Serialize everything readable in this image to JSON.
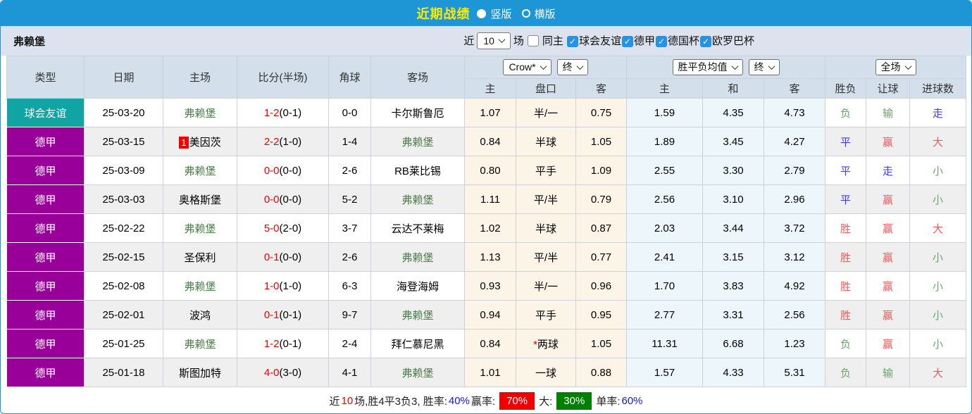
{
  "colors": {
    "accent_blue": "#1e96d5",
    "title_yellow": "#ffeb00",
    "friendly_teal": "#12a3a3",
    "league_purple": "#990099",
    "score_red": "#f00000",
    "focus_team_green": "#4a7d4a",
    "win_red": "#ef5a5a",
    "draw_blue": "#3c3cf0",
    "lose_green": "#6aa56a"
  },
  "top_bar": {
    "title": "近期战绩",
    "radio_vertical": "竖版",
    "radio_horizontal": "横版",
    "selected": "竖版"
  },
  "filter_bar": {
    "team": "弗赖堡",
    "recent_label": "近",
    "recent_count": "10",
    "games_label": "场",
    "same_home_label": "同主",
    "same_home_checked": false,
    "filters": [
      {
        "label": "球会友谊",
        "checked": true
      },
      {
        "label": "德甲",
        "checked": true
      },
      {
        "label": "德国杯",
        "checked": true
      },
      {
        "label": "欧罗巴杯",
        "checked": true
      }
    ]
  },
  "table": {
    "static_headers": [
      "类型",
      "日期",
      "主场",
      "比分(半场)",
      "角球",
      "客场"
    ],
    "group_headers": {
      "odds_source": "Crow*",
      "odds_time": "终",
      "mean_label": "胜平负均值",
      "mean_time": "终",
      "result_scope": "全场"
    },
    "sub_headers": [
      "主",
      "盘口",
      "客",
      "主",
      "和",
      "客",
      "胜负",
      "让球",
      "进球数"
    ],
    "rows": [
      {
        "type": "球会友谊",
        "type_style": "friendly",
        "date": "25-03-20",
        "home": "弗赖堡",
        "home_focus": true,
        "home_rank": "",
        "score": "1-2",
        "half": "(0-1)",
        "corner": "0-0",
        "away": "卡尔斯鲁厄",
        "away_focus": false,
        "odds_home": "1.07",
        "handicap": "半/一",
        "handicap_star": false,
        "odds_away": "0.75",
        "mean_home": "1.59",
        "mean_draw": "4.35",
        "mean_away": "4.73",
        "result": "负",
        "let_result": "输",
        "goals_result": "走"
      },
      {
        "type": "德甲",
        "type_style": "league",
        "date": "25-03-15",
        "home": "美因茨",
        "home_focus": false,
        "home_rank": "1",
        "score": "2-2",
        "half": "(1-0)",
        "corner": "1-4",
        "away": "弗赖堡",
        "away_focus": true,
        "odds_home": "0.84",
        "handicap": "半球",
        "handicap_star": false,
        "odds_away": "1.05",
        "mean_home": "1.89",
        "mean_draw": "3.45",
        "mean_away": "4.27",
        "result": "平",
        "let_result": "赢",
        "goals_result": "大"
      },
      {
        "type": "德甲",
        "type_style": "league",
        "date": "25-03-09",
        "home": "弗赖堡",
        "home_focus": true,
        "home_rank": "",
        "score": "0-0",
        "half": "(0-0)",
        "corner": "2-6",
        "away": "RB莱比锡",
        "away_focus": false,
        "odds_home": "0.80",
        "handicap": "平手",
        "handicap_star": false,
        "odds_away": "1.09",
        "mean_home": "2.55",
        "mean_draw": "3.30",
        "mean_away": "2.79",
        "result": "平",
        "let_result": "走",
        "goals_result": "小"
      },
      {
        "type": "德甲",
        "type_style": "league",
        "date": "25-03-03",
        "home": "奥格斯堡",
        "home_focus": false,
        "home_rank": "",
        "score": "0-0",
        "half": "(0-0)",
        "corner": "5-2",
        "away": "弗赖堡",
        "away_focus": true,
        "odds_home": "1.11",
        "handicap": "平/半",
        "handicap_star": false,
        "odds_away": "0.79",
        "mean_home": "2.56",
        "mean_draw": "3.10",
        "mean_away": "2.96",
        "result": "平",
        "let_result": "赢",
        "goals_result": "小"
      },
      {
        "type": "德甲",
        "type_style": "league",
        "date": "25-02-22",
        "home": "弗赖堡",
        "home_focus": true,
        "home_rank": "",
        "score": "5-0",
        "half": "(2-0)",
        "corner": "3-7",
        "away": "云达不莱梅",
        "away_focus": false,
        "odds_home": "1.02",
        "handicap": "半球",
        "handicap_star": false,
        "odds_away": "0.87",
        "mean_home": "2.03",
        "mean_draw": "3.44",
        "mean_away": "3.72",
        "result": "胜",
        "let_result": "赢",
        "goals_result": "大"
      },
      {
        "type": "德甲",
        "type_style": "league",
        "date": "25-02-15",
        "home": "圣保利",
        "home_focus": false,
        "home_rank": "",
        "score": "0-1",
        "half": "(0-0)",
        "corner": "2-6",
        "away": "弗赖堡",
        "away_focus": true,
        "odds_home": "1.13",
        "handicap": "平/半",
        "handicap_star": false,
        "odds_away": "0.77",
        "mean_home": "2.41",
        "mean_draw": "3.15",
        "mean_away": "3.12",
        "result": "胜",
        "let_result": "赢",
        "goals_result": "小"
      },
      {
        "type": "德甲",
        "type_style": "league",
        "date": "25-02-08",
        "home": "弗赖堡",
        "home_focus": true,
        "home_rank": "",
        "score": "1-0",
        "half": "(1-0)",
        "corner": "6-3",
        "away": "海登海姆",
        "away_focus": false,
        "odds_home": "0.93",
        "handicap": "半/一",
        "handicap_star": false,
        "odds_away": "0.96",
        "mean_home": "1.70",
        "mean_draw": "3.83",
        "mean_away": "4.92",
        "result": "胜",
        "let_result": "赢",
        "goals_result": "小"
      },
      {
        "type": "德甲",
        "type_style": "league",
        "date": "25-02-01",
        "home": "波鸿",
        "home_focus": false,
        "home_rank": "",
        "score": "0-1",
        "half": "(0-1)",
        "corner": "9-7",
        "away": "弗赖堡",
        "away_focus": true,
        "odds_home": "0.94",
        "handicap": "平手",
        "handicap_star": false,
        "odds_away": "0.95",
        "mean_home": "2.77",
        "mean_draw": "3.31",
        "mean_away": "2.56",
        "result": "胜",
        "let_result": "赢",
        "goals_result": "小"
      },
      {
        "type": "德甲",
        "type_style": "league",
        "date": "25-01-25",
        "home": "弗赖堡",
        "home_focus": true,
        "home_rank": "",
        "score": "1-2",
        "half": "(0-1)",
        "corner": "2-4",
        "away": "拜仁慕尼黑",
        "away_focus": false,
        "odds_home": "0.84",
        "handicap": "两球",
        "handicap_star": true,
        "odds_away": "1.05",
        "mean_home": "11.31",
        "mean_draw": "6.68",
        "mean_away": "1.23",
        "result": "负",
        "let_result": "赢",
        "goals_result": "小"
      },
      {
        "type": "德甲",
        "type_style": "league",
        "date": "25-01-18",
        "home": "斯图加特",
        "home_focus": false,
        "home_rank": "",
        "score": "4-0",
        "half": "(3-0)",
        "corner": "4-1",
        "away": "弗赖堡",
        "away_focus": true,
        "odds_home": "1.01",
        "handicap": "一球",
        "handicap_star": false,
        "odds_away": "0.88",
        "mean_home": "1.57",
        "mean_draw": "4.33",
        "mean_away": "5.31",
        "result": "负",
        "let_result": "输",
        "goals_result": "大"
      }
    ]
  },
  "footer": {
    "segments": [
      {
        "text": "近",
        "style": "plain"
      },
      {
        "text": "10",
        "style": "red"
      },
      {
        "text": "场,胜4平3负3, 胜率:",
        "style": "plain"
      },
      {
        "text": "40%",
        "style": "blue"
      },
      {
        "text": " 赢率:",
        "style": "plain"
      },
      {
        "text": "70%",
        "style": "white-on-red"
      },
      {
        "text": " 大:",
        "style": "plain"
      },
      {
        "text": "30%",
        "style": "white-on-green"
      },
      {
        "text": " 单率:",
        "style": "plain"
      },
      {
        "text": "60%",
        "style": "blue"
      }
    ]
  }
}
